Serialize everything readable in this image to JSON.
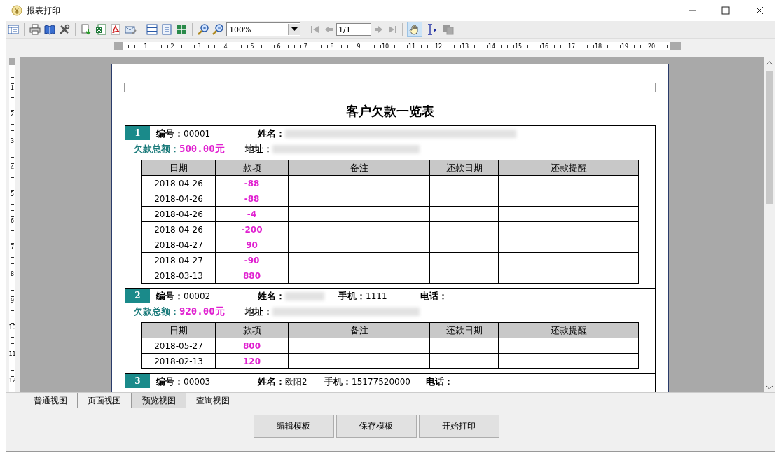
{
  "window": {
    "title": "报表打印"
  },
  "toolbar": {
    "zoom": "100%",
    "page": "1/1",
    "tools": [
      {
        "kind": "hand",
        "selected": true
      },
      {
        "kind": "text-select",
        "selected": false
      }
    ]
  },
  "hruler": [
    "1",
    "2",
    "3",
    "4",
    "5",
    "6",
    "7",
    "8",
    "9",
    "10",
    "11",
    "12",
    "13",
    "14",
    "15",
    "16",
    "17",
    "18",
    "19",
    "20"
  ],
  "vruler": [
    "1",
    "2",
    "3",
    "4",
    "5",
    "6",
    "7",
    "8",
    "9",
    "10",
    "11",
    "12"
  ],
  "report": {
    "title": "客户欠款一览表",
    "records": [
      {
        "number": "1",
        "fields": [
          {
            "label": "编号：",
            "value": "00001"
          },
          {
            "label": "姓名：",
            "blurred": true
          }
        ],
        "total_label": "欠款总额：",
        "total": "500.00元",
        "address_label": "地址：",
        "address_blurred": true,
        "columns": [
          "日期",
          "款项",
          "备注",
          "还款日期",
          "还款提醒"
        ],
        "rows": [
          {
            "date": "2018-04-26",
            "amount": "-88"
          },
          {
            "date": "2018-04-26",
            "amount": "-88"
          },
          {
            "date": "2018-04-26",
            "amount": "-4"
          },
          {
            "date": "2018-04-26",
            "amount": "-200"
          },
          {
            "date": "2018-04-27",
            "amount": "90"
          },
          {
            "date": "2018-04-27",
            "amount": "-90"
          },
          {
            "date": "2018-03-13",
            "amount": "880"
          }
        ]
      },
      {
        "number": "2",
        "fields": [
          {
            "label": "编号：",
            "value": "00002"
          },
          {
            "label": "姓名：",
            "blurred": true
          },
          {
            "label": "手机：",
            "value": "1111"
          },
          {
            "label": "电话："
          }
        ],
        "total_label": "欠款总额：",
        "total": "920.00元",
        "address_label": "地址：",
        "address_blurred": true,
        "columns": [
          "日期",
          "款项",
          "备注",
          "还款日期",
          "还款提醒"
        ],
        "rows": [
          {
            "date": "2018-05-27",
            "amount": "800"
          },
          {
            "date": "2018-02-13",
            "amount": "120"
          }
        ]
      },
      {
        "number": "3",
        "fields": [
          {
            "label": "编号：",
            "value": "00003"
          },
          {
            "label": "姓名：",
            "value": "欧阳2"
          },
          {
            "label": "手机：",
            "value": "15177520000"
          },
          {
            "label": "电话："
          }
        ]
      }
    ]
  },
  "view_tabs": [
    {
      "label": "普通视图",
      "selected": false
    },
    {
      "label": "页面视图",
      "selected": false
    },
    {
      "label": "预览视图",
      "selected": true
    },
    {
      "label": "查询视图",
      "selected": false
    }
  ],
  "buttons": [
    "编辑模板",
    "保存模板",
    "开始打印"
  ]
}
